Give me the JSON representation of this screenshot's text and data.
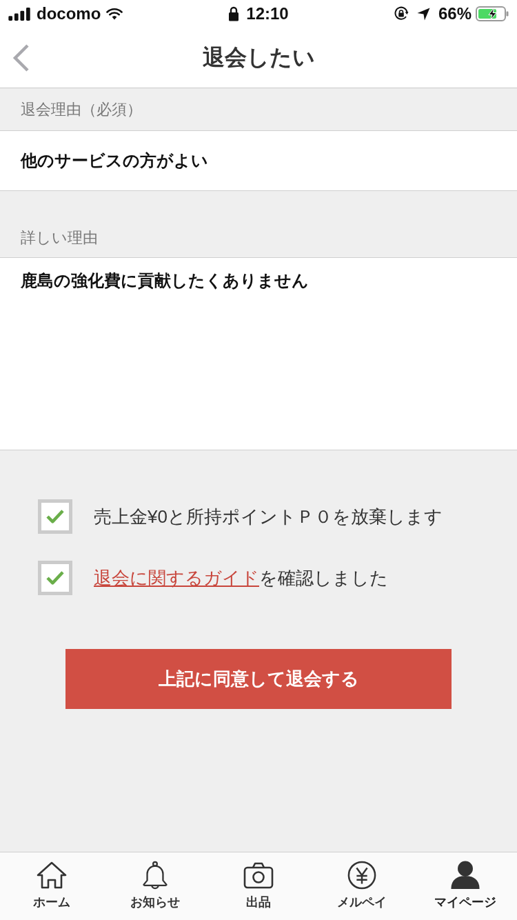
{
  "status_bar": {
    "carrier": "docomo",
    "time": "12:10",
    "battery": "66%"
  },
  "nav": {
    "title": "退会したい"
  },
  "reason": {
    "label": "退会理由（必須）",
    "value": "他のサービスの方がよい"
  },
  "detail": {
    "label": "詳しい理由",
    "value": "鹿島の強化費に貢献したくありません"
  },
  "agreements": [
    {
      "kind": "text",
      "text": "売上金¥0と所持ポイントＰ０を放棄します",
      "checked": true
    },
    {
      "kind": "link",
      "link": "退会に関するガイド",
      "text": "を確認しました",
      "checked": true
    }
  ],
  "submit_button": "上記に同意して退会する",
  "tabs": [
    {
      "kind": "home",
      "label": "ホーム",
      "selected": false
    },
    {
      "kind": "bell",
      "label": "お知らせ",
      "selected": false
    },
    {
      "kind": "camera",
      "label": "出品",
      "selected": false
    },
    {
      "kind": "yen",
      "label": "メルペイ",
      "selected": false
    },
    {
      "kind": "person",
      "label": "マイページ",
      "selected": true
    }
  ]
}
